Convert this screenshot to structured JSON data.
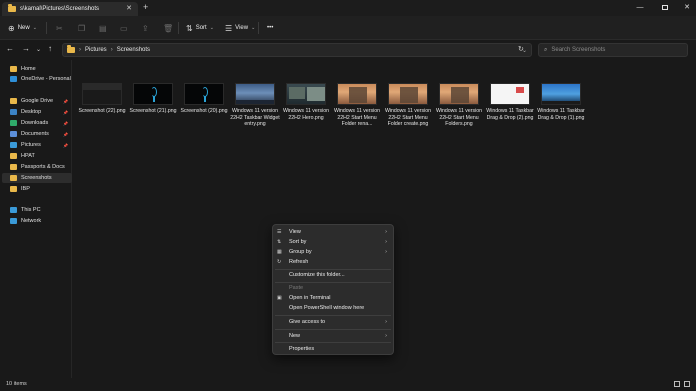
{
  "window": {
    "tab_title": "s\\kamal\\Pictures\\Screenshots",
    "tab_close": "✕",
    "new_tab": "+",
    "min": "—",
    "close": "✕"
  },
  "toolbar": {
    "new_label": "New",
    "sort_label": "Sort",
    "view_label": "View",
    "more_label": "•••"
  },
  "address": {
    "crumbs": [
      "Pictures",
      "Screenshots"
    ],
    "search_placeholder": "Search Screenshots"
  },
  "sidebar": {
    "top": [
      {
        "label": "Home",
        "icon": "home-icon",
        "color": "#e9b84a"
      },
      {
        "label": "OneDrive - Personal",
        "icon": "cloud-icon",
        "color": "#2f8fd8"
      }
    ],
    "quick": [
      {
        "label": "Google Drive",
        "icon": "folder-icon",
        "color": "#e9b84a",
        "pinned": true
      },
      {
        "label": "Desktop",
        "icon": "desktop-icon",
        "color": "#3b82c4",
        "pinned": true
      },
      {
        "label": "Downloads",
        "icon": "download-icon",
        "color": "#2faa6a",
        "pinned": true
      },
      {
        "label": "Documents",
        "icon": "documents-icon",
        "color": "#5b8ed8",
        "pinned": true
      },
      {
        "label": "Pictures",
        "icon": "pictures-icon",
        "color": "#3a9ad8",
        "pinned": true
      },
      {
        "label": "HPAT",
        "icon": "folder-icon",
        "color": "#e9b84a",
        "pinned": false
      },
      {
        "label": "Passports & Docs",
        "icon": "folder-icon",
        "color": "#e9b84a",
        "pinned": false
      },
      {
        "label": "Screenshots",
        "icon": "folder-icon",
        "color": "#e9b84a",
        "pinned": false,
        "active": true
      },
      {
        "label": "IBP",
        "icon": "folder-icon",
        "color": "#e9b84a",
        "pinned": false
      }
    ],
    "bottom": [
      {
        "label": "This PC",
        "icon": "pc-icon",
        "color": "#3a9ad8"
      },
      {
        "label": "Network",
        "icon": "network-icon",
        "color": "#3a9ad8"
      }
    ]
  },
  "files": [
    {
      "name": "Screenshot (22).png",
      "thumb": "screen22"
    },
    {
      "name": "Screenshot (21).png",
      "thumb": "dark"
    },
    {
      "name": "Screenshot (20).png",
      "thumb": "dark"
    },
    {
      "name": "Windows 11 version 22H2 Taskbar Widget entry.png",
      "thumb": "widget"
    },
    {
      "name": "Windows 11 version 22H2 Hero.png",
      "thumb": "hero"
    },
    {
      "name": "Windows 11 version 22H2 Start Menu Folder rena...",
      "thumb": "start"
    },
    {
      "name": "Windows 11 version 22H2 Start Menu Folder create.png",
      "thumb": "start"
    },
    {
      "name": "Windows 11 version 22H2 Start Menu Folders.png",
      "thumb": "start"
    },
    {
      "name": "Windows 11 Taskbar Drag & Drop (2).png",
      "thumb": "white"
    },
    {
      "name": "Windows 11 Taskbar Drag & Drop (1).png",
      "thumb": "beach"
    }
  ],
  "context_menu": {
    "view": "View",
    "sort_by": "Sort by",
    "group_by": "Group by",
    "refresh": "Refresh",
    "customize": "Customize this folder...",
    "paste": "Paste",
    "open_terminal": "Open in Terminal",
    "open_powershell": "Open PowerShell window here",
    "give_access": "Give access to",
    "new": "New",
    "properties": "Properties"
  },
  "status": {
    "count": "10 items"
  }
}
